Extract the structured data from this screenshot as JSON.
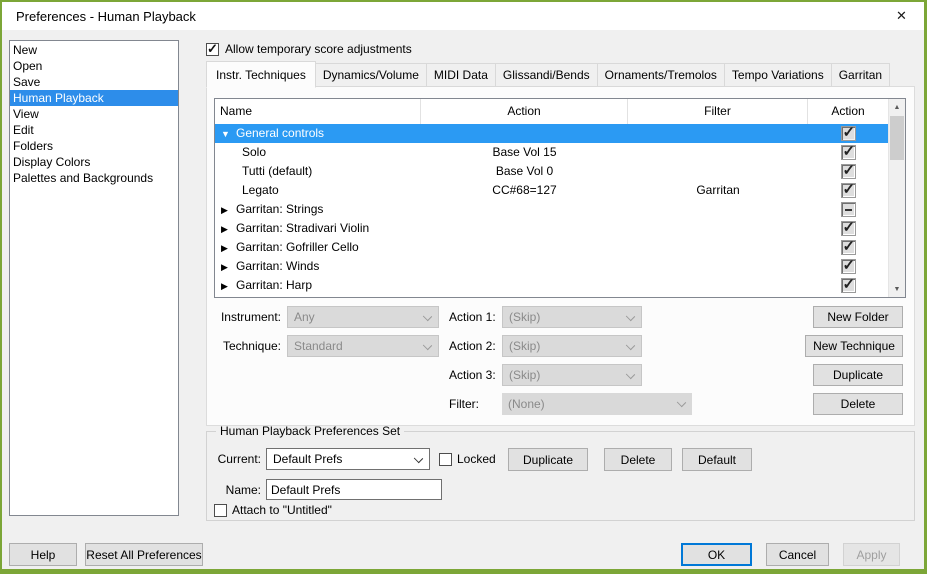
{
  "window": {
    "title": "Preferences - Human Playback",
    "close_glyph": "✕"
  },
  "colors": {
    "frame_green": "#7CA637",
    "sidebar_selection": "#2D8DEA",
    "row_selection": "#2B9AF3",
    "ok_focus_border": "#0078D7",
    "dialog_bg": "#F0F0F0"
  },
  "sidebar": {
    "items": [
      {
        "label": "New",
        "classes": ""
      },
      {
        "label": "Open",
        "classes": ""
      },
      {
        "label": "Save",
        "classes": ""
      },
      {
        "label": "Human Playback",
        "classes": "selected"
      },
      {
        "label": "View",
        "classes": ""
      },
      {
        "label": "Edit",
        "classes": ""
      },
      {
        "label": "Folders",
        "classes": ""
      },
      {
        "label": "Display Colors",
        "classes": ""
      },
      {
        "label": "Palettes and Backgrounds",
        "classes": ""
      }
    ]
  },
  "allow_checkbox": {
    "label": "Allow temporary score adjustments",
    "checked": true
  },
  "tabs": [
    {
      "label": "Instr. Techniques",
      "classes": "active"
    },
    {
      "label": "Dynamics/Volume",
      "classes": ""
    },
    {
      "label": "MIDI Data",
      "classes": ""
    },
    {
      "label": "Glissandi/Bends",
      "classes": ""
    },
    {
      "label": "Ornaments/Tremolos",
      "classes": ""
    },
    {
      "label": "Tempo Variations",
      "classes": ""
    },
    {
      "label": "Garritan",
      "classes": ""
    }
  ],
  "table": {
    "headers": {
      "name": "Name",
      "action": "Action",
      "filter": "Filter",
      "enabled": "Action"
    },
    "rows": [
      {
        "twisty": "▼",
        "name": "General controls",
        "action": "",
        "filter": "",
        "check": "checked",
        "classes": "selected"
      },
      {
        "twisty": "",
        "name": "Solo",
        "action": "Base Vol 15",
        "filter": "",
        "check": "checked",
        "classes": "lvl1"
      },
      {
        "twisty": "",
        "name": "Tutti (default)",
        "action": "Base Vol 0",
        "filter": "",
        "check": "checked",
        "classes": "lvl1"
      },
      {
        "twisty": "",
        "name": "Legato",
        "action": "CC#68=127",
        "filter": "Garritan",
        "check": "checked",
        "classes": "lvl1"
      },
      {
        "twisty": "▶",
        "name": "Garritan: Strings",
        "action": "",
        "filter": "",
        "check": "mixed",
        "classes": ""
      },
      {
        "twisty": "▶",
        "name": "Garritan: Stradivari Violin",
        "action": "",
        "filter": "",
        "check": "checked",
        "classes": ""
      },
      {
        "twisty": "▶",
        "name": "Garritan: Gofriller Cello",
        "action": "",
        "filter": "",
        "check": "checked",
        "classes": ""
      },
      {
        "twisty": "▶",
        "name": "Garritan: Winds",
        "action": "",
        "filter": "",
        "check": "checked",
        "classes": ""
      },
      {
        "twisty": "▶",
        "name": "Garritan: Harp",
        "action": "",
        "filter": "",
        "check": "checked",
        "classes": ""
      }
    ],
    "scrollbar": {
      "up_icon": "▲",
      "down_icon": "▼"
    }
  },
  "editors": {
    "instrument": {
      "label": "Instrument:",
      "value": "Any"
    },
    "technique": {
      "label": "Technique:",
      "value": "Standard"
    },
    "action1": {
      "label": "Action 1:",
      "value": "(Skip)"
    },
    "action2": {
      "label": "Action 2:",
      "value": "(Skip)"
    },
    "action3": {
      "label": "Action 3:",
      "value": "(Skip)"
    },
    "filter": {
      "label": "Filter:",
      "value": "(None)"
    }
  },
  "panel_buttons": {
    "new_folder": "New Folder",
    "new_technique": "New Technique",
    "duplicate": "Duplicate",
    "delete": "Delete"
  },
  "prefs_set": {
    "title": "Human Playback Preferences Set",
    "current_label": "Current:",
    "current_value": "Default Prefs",
    "locked_label": "Locked",
    "duplicate": "Duplicate",
    "delete": "Delete",
    "default": "Default",
    "name_label": "Name:",
    "name_value": "Default Prefs",
    "attach_label": "Attach to \"Untitled\""
  },
  "footer": {
    "help": "Help",
    "reset": "Reset All Preferences",
    "ok": "OK",
    "cancel": "Cancel",
    "apply": "Apply"
  }
}
